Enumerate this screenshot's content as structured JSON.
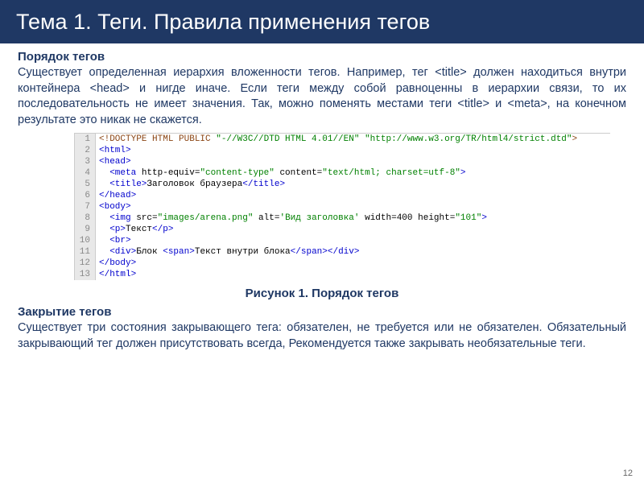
{
  "header": {
    "title": "Тема 1. Теги. Правила применения тегов"
  },
  "section1": {
    "title": "Порядок тегов",
    "paragraph": "Существует определенная иерархия вложенности тегов. Например, тег <title> должен находиться внутри контейнера <head> и нигде иначе.\nЕсли теги между собой равноценны в иерархии связи, то их последовательность не имеет значения. Так, можно поменять местами теги <title> и <meta>, на конечном результате это никак не скажется."
  },
  "code": {
    "lines": [
      {
        "n": "1",
        "parts": [
          {
            "c": "doctype",
            "t": "<!DOCTYPE HTML PUBLIC "
          },
          {
            "c": "string",
            "t": "\"-//W3C//DTD HTML 4.01//EN\" \"http://www.w3.org/TR/html4/strict.dtd\""
          },
          {
            "c": "doctype",
            "t": ">"
          }
        ]
      },
      {
        "n": "2",
        "parts": [
          {
            "c": "tag",
            "t": "<html>"
          }
        ]
      },
      {
        "n": "3",
        "parts": [
          {
            "c": "tag",
            "t": "<head>"
          }
        ]
      },
      {
        "n": "4",
        "parts": [
          {
            "c": "txt",
            "t": "  "
          },
          {
            "c": "tag",
            "t": "<meta"
          },
          {
            "c": "txt",
            "t": " http-equiv="
          },
          {
            "c": "string",
            "t": "\"content-type\""
          },
          {
            "c": "txt",
            "t": " content="
          },
          {
            "c": "string",
            "t": "\"text/html; charset=utf-8\""
          },
          {
            "c": "tag",
            "t": ">"
          }
        ]
      },
      {
        "n": "5",
        "parts": [
          {
            "c": "txt",
            "t": "  "
          },
          {
            "c": "tag",
            "t": "<title>"
          },
          {
            "c": "txt",
            "t": "Заголовок браузера"
          },
          {
            "c": "tag",
            "t": "</title>"
          }
        ]
      },
      {
        "n": "6",
        "parts": [
          {
            "c": "tag",
            "t": "</head>"
          }
        ]
      },
      {
        "n": "7",
        "parts": [
          {
            "c": "tag",
            "t": "<body>"
          }
        ]
      },
      {
        "n": "8",
        "parts": [
          {
            "c": "txt",
            "t": "  "
          },
          {
            "c": "tag",
            "t": "<img"
          },
          {
            "c": "txt",
            "t": " src="
          },
          {
            "c": "string",
            "t": "\"images/arena.png\""
          },
          {
            "c": "txt",
            "t": " alt="
          },
          {
            "c": "string",
            "t": "'Вид заголовка'"
          },
          {
            "c": "txt",
            "t": " width=400 height="
          },
          {
            "c": "string",
            "t": "\"101\""
          },
          {
            "c": "tag",
            "t": ">"
          }
        ]
      },
      {
        "n": "9",
        "parts": [
          {
            "c": "txt",
            "t": "  "
          },
          {
            "c": "tag",
            "t": "<p>"
          },
          {
            "c": "txt",
            "t": "Текст"
          },
          {
            "c": "tag",
            "t": "</p>"
          }
        ]
      },
      {
        "n": "10",
        "parts": [
          {
            "c": "txt",
            "t": "  "
          },
          {
            "c": "tag",
            "t": "<br>"
          }
        ]
      },
      {
        "n": "11",
        "parts": [
          {
            "c": "txt",
            "t": "  "
          },
          {
            "c": "tag",
            "t": "<div>"
          },
          {
            "c": "txt",
            "t": "Блок "
          },
          {
            "c": "tag",
            "t": "<span>"
          },
          {
            "c": "txt",
            "t": "Текст внутри блока"
          },
          {
            "c": "tag",
            "t": "</span></div>"
          }
        ]
      },
      {
        "n": "12",
        "parts": [
          {
            "c": "tag",
            "t": "</body>"
          }
        ]
      },
      {
        "n": "13",
        "parts": [
          {
            "c": "tag",
            "t": "</html>"
          }
        ]
      }
    ]
  },
  "caption": "Рисунок 1. Порядок тегов",
  "section2": {
    "title": "Закрытие тегов",
    "paragraph": "Существует три состояния закрывающего тега: обязателен, не требуется или не обязателен. Обязательный закрывающий тег должен присутствовать всегда, Рекомендуется также закрывать необязательные теги."
  },
  "pagenum": "12"
}
